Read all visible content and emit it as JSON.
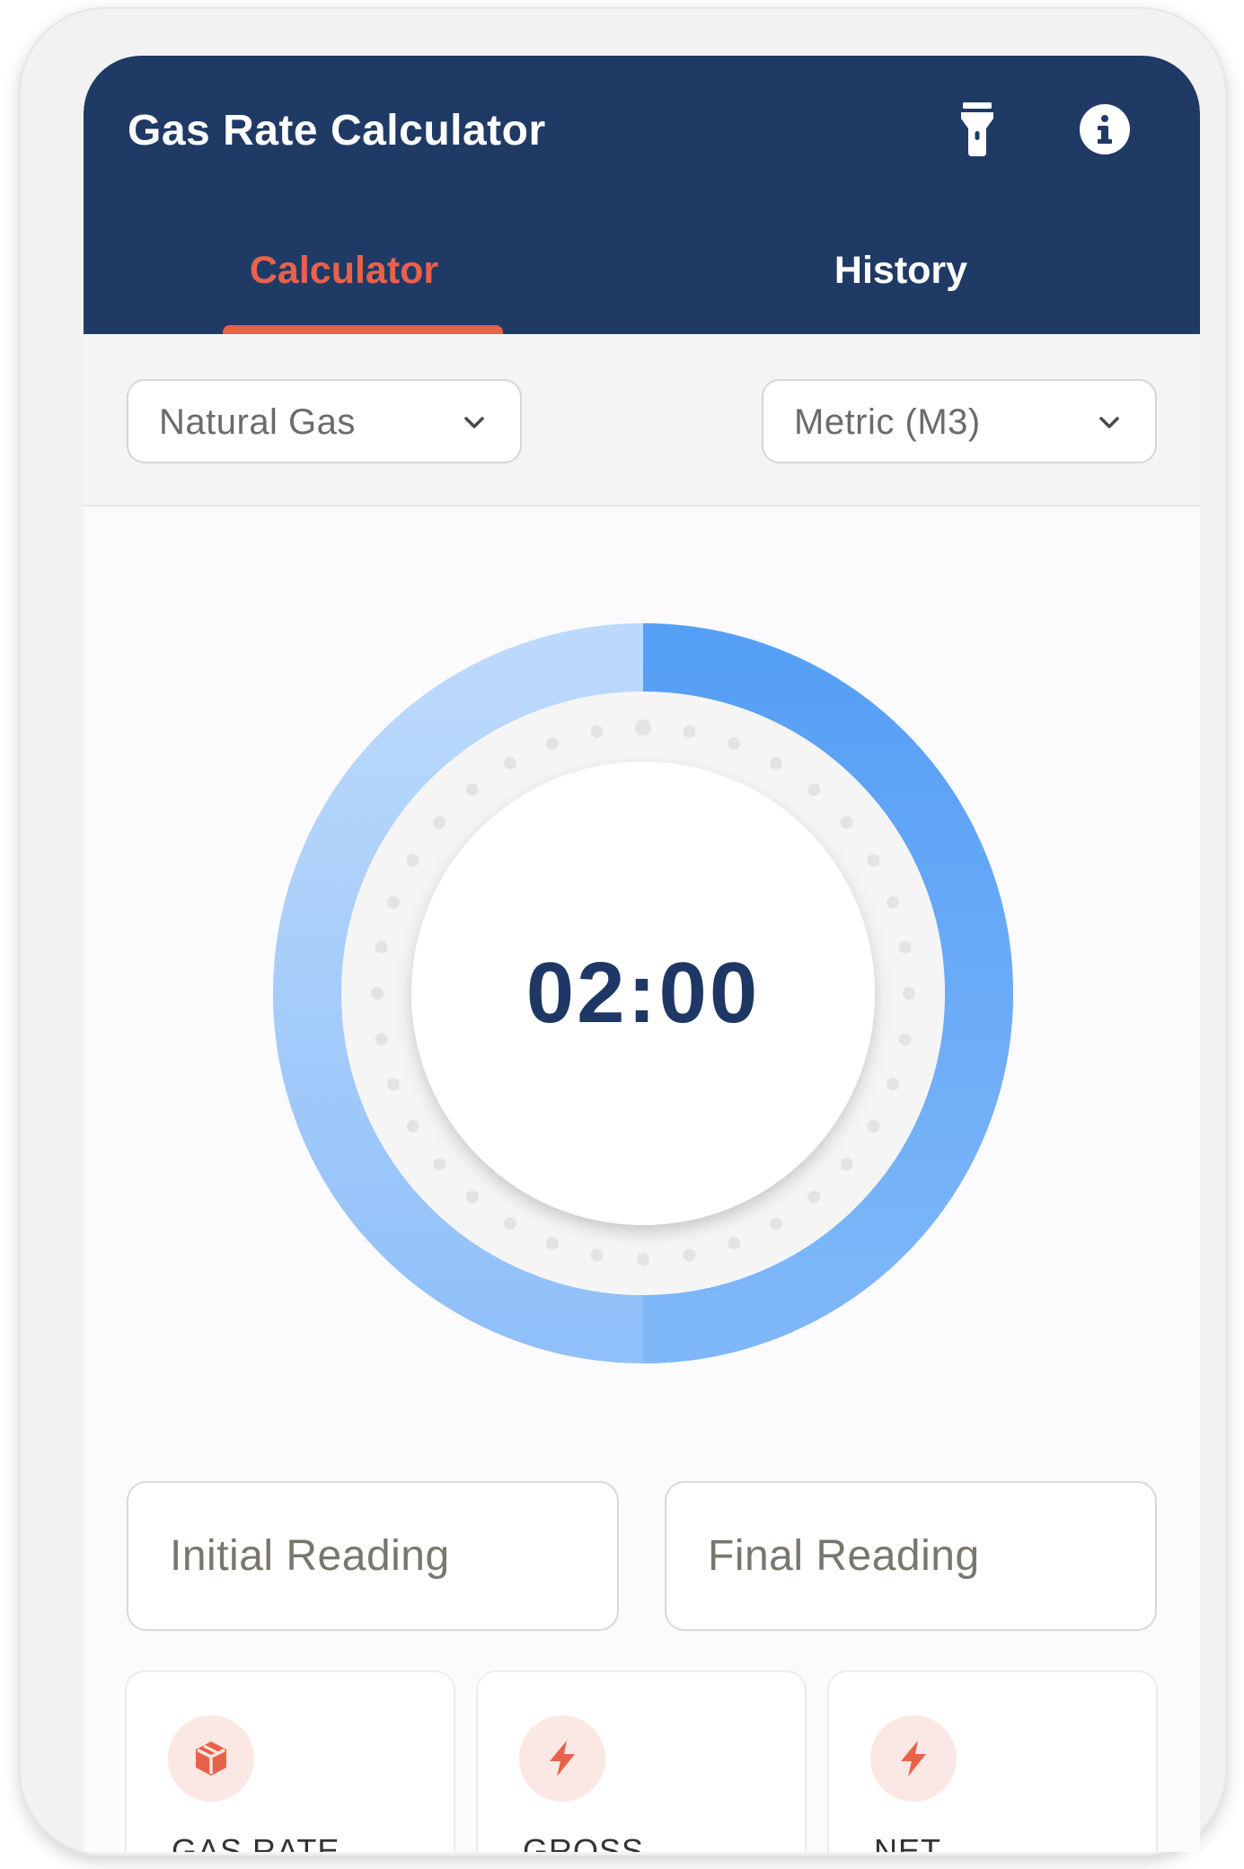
{
  "app": {
    "title": "Gas Rate Calculator",
    "icons": [
      "flashlight-icon",
      "info-icon"
    ]
  },
  "tabs": [
    {
      "label": "Calculator",
      "active": true
    },
    {
      "label": "History",
      "active": false
    }
  ],
  "selectors": {
    "gas_type": "Natural Gas",
    "unit_system": "Metric (M3)"
  },
  "timer": {
    "display": "02:00",
    "progress_fraction": 0.5
  },
  "inputs": {
    "initial_placeholder": "Initial Reading",
    "final_placeholder": "Final Reading"
  },
  "results": [
    {
      "label": "GAS RATE",
      "icon": "cube-icon"
    },
    {
      "label": "GROSS",
      "icon": "lightning-icon"
    },
    {
      "label": "NET",
      "icon": "lightning-icon"
    }
  ],
  "colors": {
    "header": "#203a66",
    "accent": "#e8624a",
    "progress": "#5aa0f7",
    "track": "#b8d6fb"
  }
}
